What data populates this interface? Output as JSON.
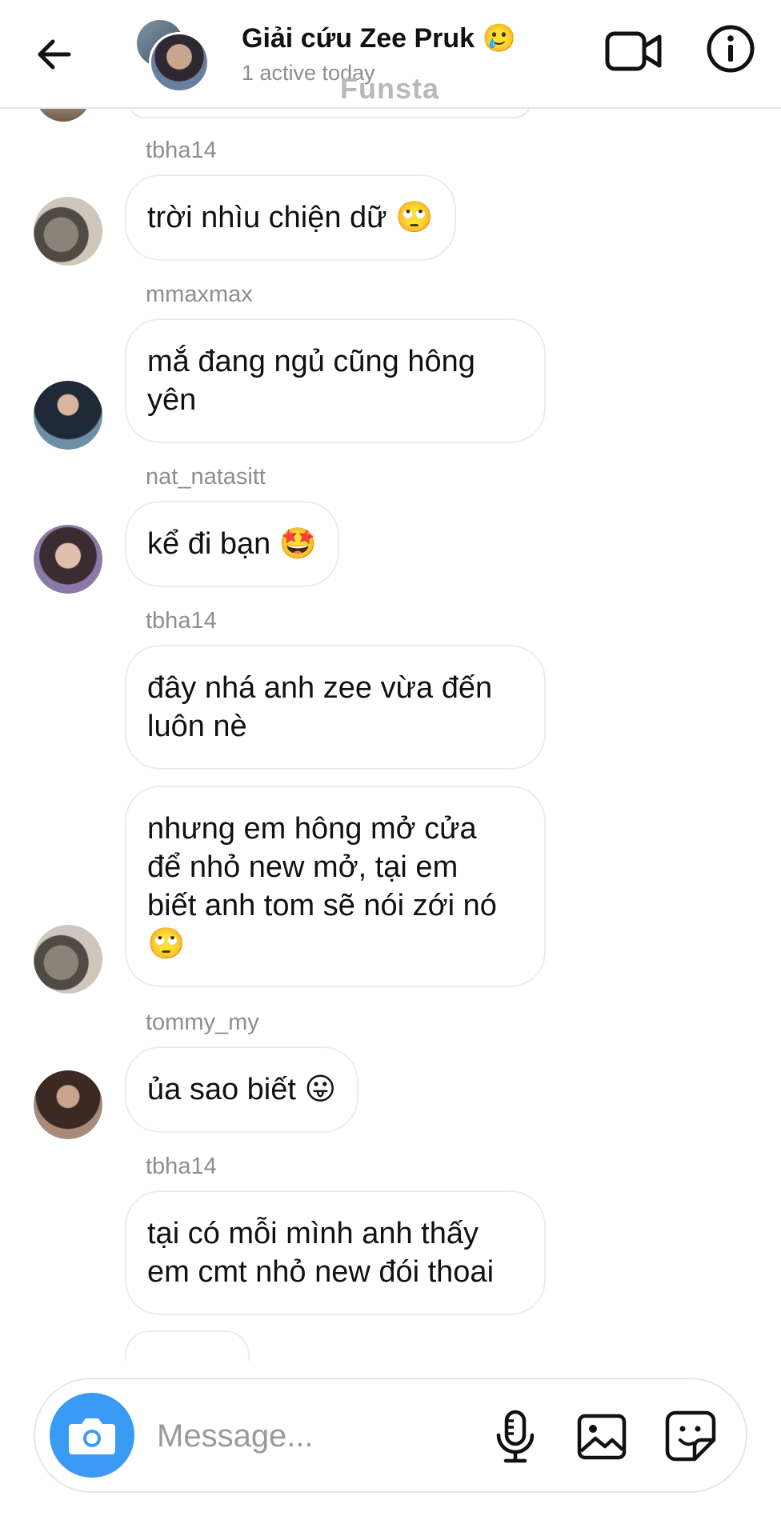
{
  "header": {
    "title": "Giải cứu Zee Pruk",
    "title_emoji": "🥲",
    "subtitle": "1 active today",
    "watermark": "Funsta"
  },
  "messages": [
    {
      "sender": "tbha14",
      "lines": [
        "trời nhìu chiện dữ 🙄"
      ]
    },
    {
      "sender": "mmaxmax",
      "lines": [
        "mắ đang ngủ cũng hông",
        "yên"
      ]
    },
    {
      "sender": "nat_natasitt",
      "lines": [
        "kể đi bạn 🤩"
      ]
    },
    {
      "sender": "tbha14",
      "lines": [
        "đây nhá anh zee vừa đến",
        "luôn nè"
      ]
    },
    {
      "sender": "",
      "lines": [
        "nhưng em hông mở cửa",
        "để nhỏ new mở, tại em",
        "biết anh tom sẽ nói zới nó",
        "🙄"
      ]
    },
    {
      "sender": "tommy_my",
      "lines": [
        "ủa sao biết 😛"
      ]
    },
    {
      "sender": "tbha14",
      "lines": [
        "tại có mỗi mình anh thấy",
        "em cmt nhỏ new đói thoai"
      ]
    }
  ],
  "composer": {
    "placeholder": "Message..."
  },
  "colors": {
    "accent": "#3a9bf5",
    "meta_text": "#8e8e8e",
    "bubble_border": "#ececec"
  },
  "icons": {
    "back": "arrow-left-icon",
    "video": "video-camera-icon",
    "info": "info-icon",
    "camera": "camera-icon",
    "mic": "microphone-icon",
    "gallery": "image-icon",
    "sticker": "sticker-icon"
  }
}
